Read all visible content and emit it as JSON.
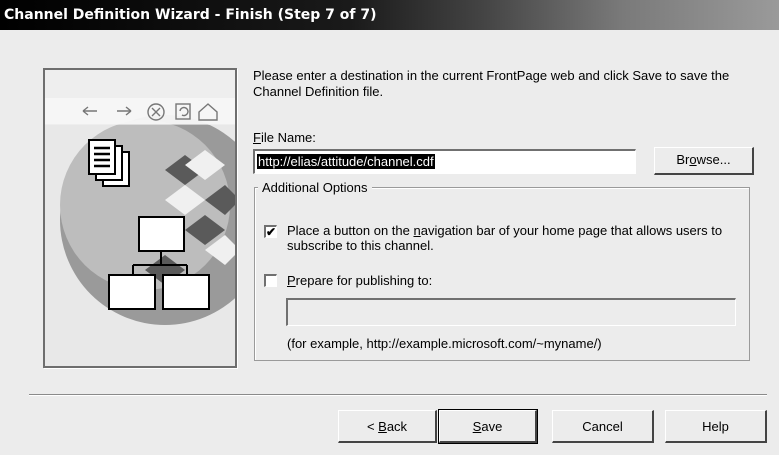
{
  "window": {
    "title": "Channel Definition Wizard - Finish (Step 7 of 7)"
  },
  "intro": "Please enter a destination in the current FrontPage web and click Save to save the Channel Definition file.",
  "file_name": {
    "label_accel": "F",
    "label_rest": "ile Name:",
    "value": "http://elias/attitude/channel.cdf",
    "browse_pre": "Br",
    "browse_accel": "o",
    "browse_post": "wse..."
  },
  "additional_options": {
    "legend": "Additional Options",
    "nav_button": {
      "checked": true,
      "check_mark": "✔",
      "text_pre": "Place a button on the ",
      "text_accel": "n",
      "text_post": "avigation bar of your home page that allows users to subscribe to this channel."
    },
    "publish": {
      "checked": false,
      "text_accel": "P",
      "text_rest": "repare for publishing to:",
      "value": "",
      "example": "(for example, http://example.microsoft.com/~myname/)"
    }
  },
  "buttons": {
    "back_pre": "< ",
    "back_accel": "B",
    "back_post": "ack",
    "save_accel": "S",
    "save_post": "ave",
    "cancel": "Cancel",
    "help": "Help"
  }
}
